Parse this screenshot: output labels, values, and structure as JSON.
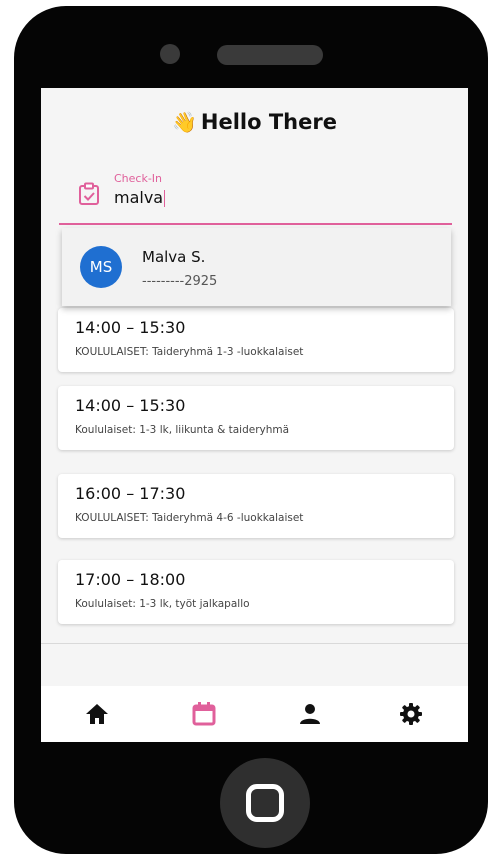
{
  "header": {
    "emoji": "👋",
    "title": "Hello There"
  },
  "checkin": {
    "label": "Check-In",
    "value": "malva",
    "icon": "clipboard-check-icon"
  },
  "suggestion": {
    "initials": "MS",
    "name": "Malva S.",
    "phone": "---------2925"
  },
  "sessions": [
    {
      "time": "14:00 – 15:30",
      "description": "KOULULAISET: Taideryhmä 1-3 -luokkalaiset"
    },
    {
      "time": "14:00 – 15:30",
      "description": "Koululaiset: 1-3 lk, liikunta & taideryhmä"
    },
    {
      "time": "16:00 – 17:30",
      "description": "KOULULAISET: Taideryhmä 4-6 -luokkalaiset"
    },
    {
      "time": "17:00 – 18:00",
      "description": "Koululaiset: 1-3 lk, työt jalkapallo"
    }
  ],
  "nav": [
    {
      "icon": "home-icon",
      "active": false
    },
    {
      "icon": "calendar-icon",
      "active": true
    },
    {
      "icon": "person-icon",
      "active": false
    },
    {
      "icon": "gear-icon",
      "active": false
    }
  ],
  "colors": {
    "accent": "#e0609b",
    "avatar": "#1f6fd1",
    "frame": "#050505"
  }
}
